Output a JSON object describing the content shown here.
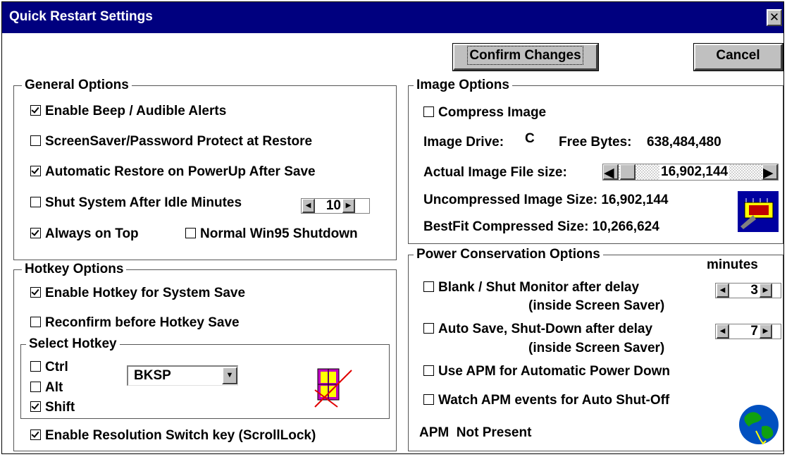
{
  "window": {
    "title": "Quick Restart Settings",
    "close_glyph": "✕"
  },
  "buttons": {
    "confirm": "Confirm Changes",
    "cancel": "Cancel"
  },
  "general": {
    "title": "General Options",
    "beep": "Enable Beep / Audible Alerts",
    "screensaver": "ScreenSaver/Password Protect at Restore",
    "auto_restore": "Automatic Restore on PowerUp After Save",
    "shut_idle": "Shut System After Idle Minutes",
    "idle_minutes": "10",
    "always_top": "Always on Top",
    "normal_shutdown": "Normal Win95 Shutdown"
  },
  "hotkey": {
    "title": "Hotkey Options",
    "enable": "Enable Hotkey for System Save",
    "reconfirm": "Reconfirm before Hotkey Save",
    "select_title": "Select Hotkey",
    "ctrl": "Ctrl",
    "alt": "Alt",
    "shift": "Shift",
    "key_value": "BKSP",
    "resolution": "Enable Resolution Switch key (ScrollLock)"
  },
  "image": {
    "title": "Image Options",
    "compress": "Compress Image",
    "drive_label": "Image Drive:",
    "drive_value": "C",
    "free_label": "Free Bytes:",
    "free_value": "638,484,480",
    "actual_label": "Actual Image File size:",
    "actual_value": "16,902,144",
    "uncompressed": "Uncompressed Image Size: 16,902,144",
    "bestfit": "BestFit Compressed Size: 10,266,624"
  },
  "power": {
    "title": "Power Conservation Options",
    "minutes": "minutes",
    "blank_line1": "Blank / Shut Monitor after delay",
    "blank_line2": "(inside Screen Saver)",
    "blank_value": "3",
    "autosave_line1": "Auto Save, Shut-Down after delay",
    "autosave_line2": "(inside Screen Saver)",
    "autosave_value": "7",
    "use_apm": "Use APM for Automatic Power Down",
    "watch_apm": "Watch APM events for Auto Shut-Off",
    "apm_status": "APM  Not Present"
  },
  "icons": {
    "left_arrow": "◀",
    "right_arrow": "▶",
    "down_arrow": "▼"
  },
  "colors": {
    "titlebar": "#00007f",
    "face": "#c0c0c0"
  }
}
